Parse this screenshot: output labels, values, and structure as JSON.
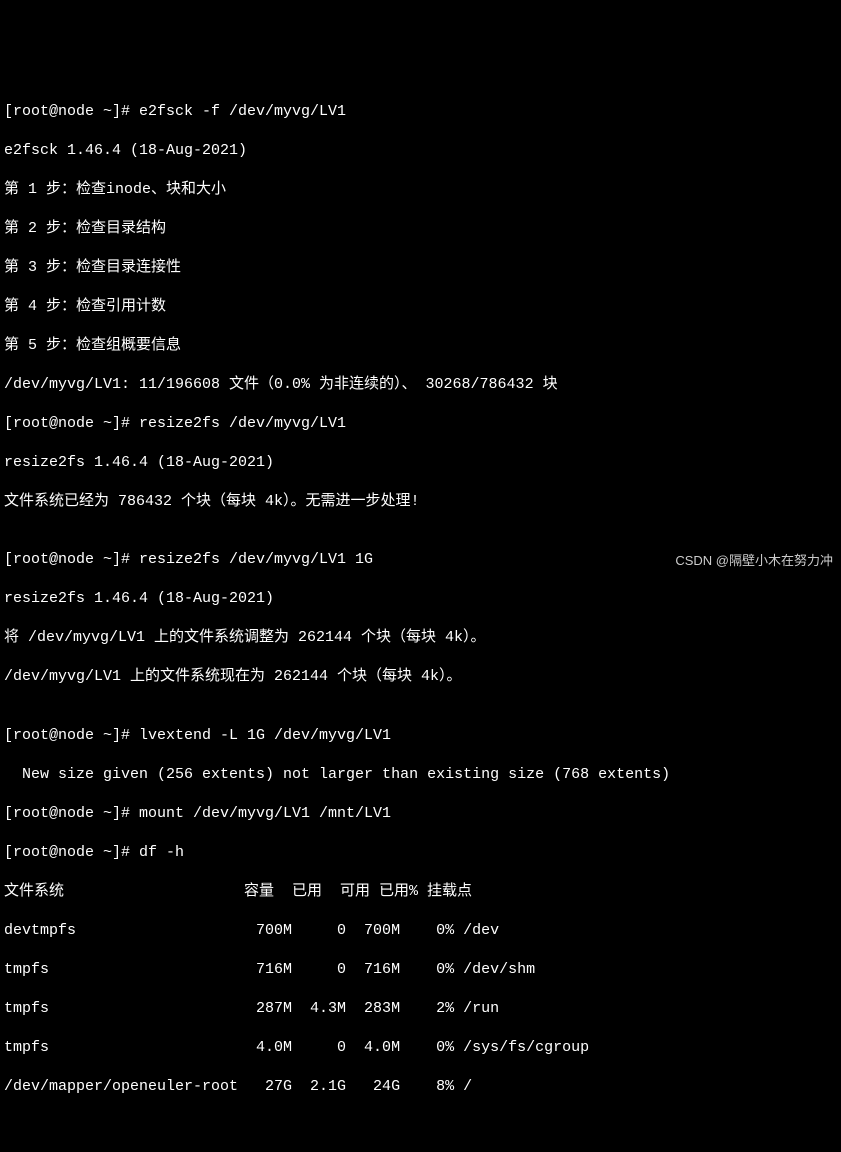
{
  "lines": [
    "[root@node ~]# e2fsck -f /dev/myvg/LV1",
    "e2fsck 1.46.4 (18-Aug-2021)",
    "第 1 步：检查inode、块和大小",
    "第 2 步：检查目录结构",
    "第 3 步：检查目录连接性",
    "第 4 步：检查引用计数",
    "第 5 步：检查组概要信息",
    "/dev/myvg/LV1: 11/196608 文件（0.0% 为非连续的）、 30268/786432 块",
    "[root@node ~]# resize2fs /dev/myvg/LV1",
    "resize2fs 1.46.4 (18-Aug-2021)",
    "文件系统已经为 786432 个块（每块 4k）。无需进一步处理!",
    "",
    "[root@node ~]# resize2fs /dev/myvg/LV1 1G",
    "resize2fs 1.46.4 (18-Aug-2021)",
    "将 /dev/myvg/LV1 上的文件系统调整为 262144 个块（每块 4k）。",
    "/dev/myvg/LV1 上的文件系统现在为 262144 个块（每块 4k）。",
    "",
    "[root@node ~]# lvextend -L 1G /dev/myvg/LV1",
    "  New size given (256 extents) not larger than existing size (768 extents)",
    "[root@node ~]# mount /dev/myvg/LV1 /mnt/LV1",
    "[root@node ~]# df -h",
    "文件系统                    容量  已用  可用 已用% 挂载点",
    "devtmpfs                    700M     0  700M    0% /dev",
    "tmpfs                       716M     0  716M    0% /dev/shm",
    "tmpfs                       287M  4.3M  283M    2% /run",
    "tmpfs                       4.0M     0  4.0M    0% /sys/fs/cgroup",
    "/dev/mapper/openeuler-root   27G  2.1G   24G    8% /"
  ],
  "watermark": "CSDN @隔壁小木在努力冲"
}
